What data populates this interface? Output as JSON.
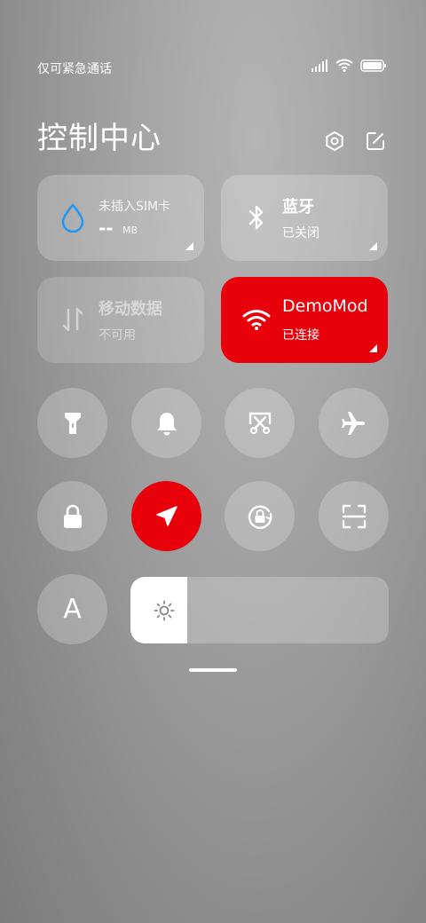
{
  "status_bar": {
    "carrier_text": "仅可紧急通话",
    "icons": [
      "signal-icon",
      "wifi-icon",
      "battery-icon"
    ]
  },
  "header": {
    "title": "控制中心",
    "icons": [
      "settings-icon",
      "edit-icon"
    ]
  },
  "tiles": {
    "data_usage": {
      "label": "未插入SIM卡",
      "value": "--",
      "unit": "MB",
      "icon": "water-drop-icon"
    },
    "bluetooth": {
      "label": "蓝牙",
      "status": "已关闭",
      "icon": "bluetooth-icon"
    },
    "mobile_data": {
      "label": "移动数据",
      "status": "不可用",
      "icon": "data-arrows-icon"
    },
    "wifi": {
      "label": "DemoMod",
      "status": "已连接",
      "icon": "wifi-icon"
    }
  },
  "toggles": [
    {
      "icon": "flashlight-icon",
      "active": false
    },
    {
      "icon": "bell-icon",
      "active": false
    },
    {
      "icon": "screenshot-icon",
      "active": false
    },
    {
      "icon": "airplane-icon",
      "active": false
    },
    {
      "icon": "lock-icon",
      "active": false
    },
    {
      "icon": "location-icon",
      "active": true
    },
    {
      "icon": "rotation-lock-icon",
      "active": false
    },
    {
      "icon": "scan-icon",
      "active": false
    },
    {
      "icon": "font-size-icon",
      "label": "A",
      "active": false
    }
  ],
  "brightness": {
    "level": 0.22,
    "icon": "brightness-icon"
  },
  "colors": {
    "accent_red": "#e8000b",
    "drop_blue": "#2196f3"
  }
}
